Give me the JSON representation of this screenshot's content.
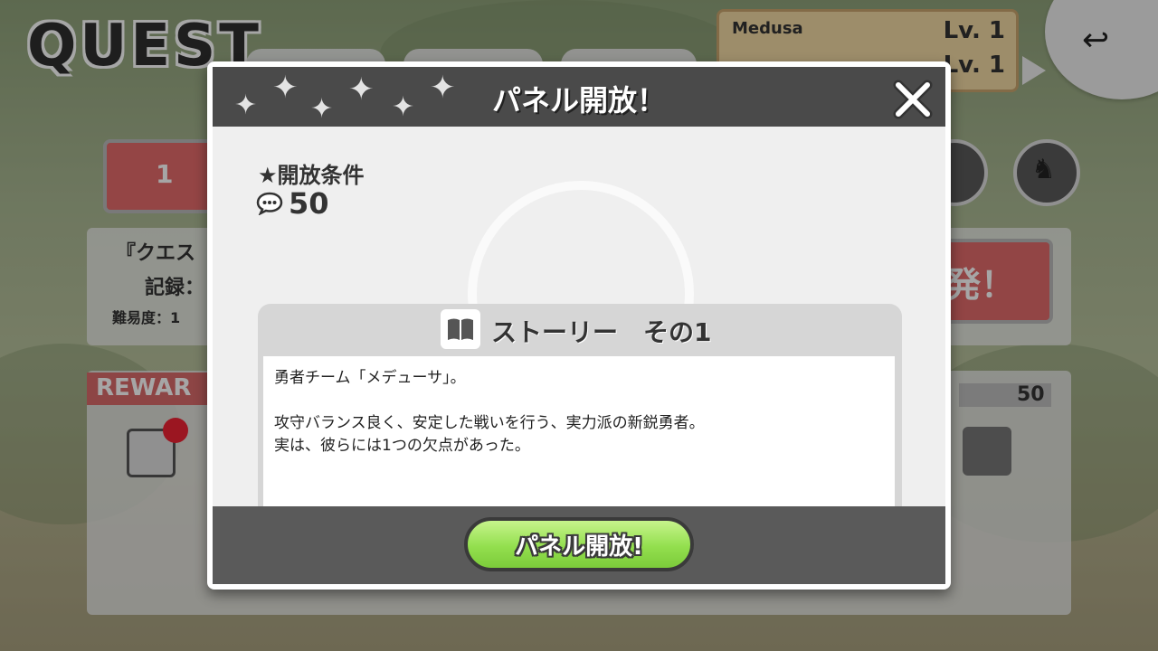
{
  "background": {
    "screen_title": "QUEST",
    "party": {
      "name": "Medusa",
      "level_1": "Lv. 1",
      "level_2": "Lv. 1"
    },
    "stage_number": "1",
    "quest_name_partial": "『クエス",
    "record_label": "記録：",
    "difficulty": "難易度：1",
    "start_button_partial": "発！",
    "reward_label": "REWAR",
    "reward_count": "50"
  },
  "modal": {
    "title": "パネル開放！",
    "condition_label": "★開放条件",
    "condition_value": "50",
    "condition_icon": "speech-bubble-icon",
    "story": {
      "title": "ストーリー　その1",
      "icon": "book-icon",
      "lines": [
        "勇者チーム「メデューサ」。",
        "",
        "攻守バランス良く、安定した戦いを行う、実力派の新鋭勇者。",
        "実は、彼らには1つの欠点があった。"
      ]
    },
    "open_button_label": "パネル開放!",
    "colors": {
      "header": "#4a4a4a",
      "button_green": "#93df4e",
      "body": "#efefef"
    }
  }
}
